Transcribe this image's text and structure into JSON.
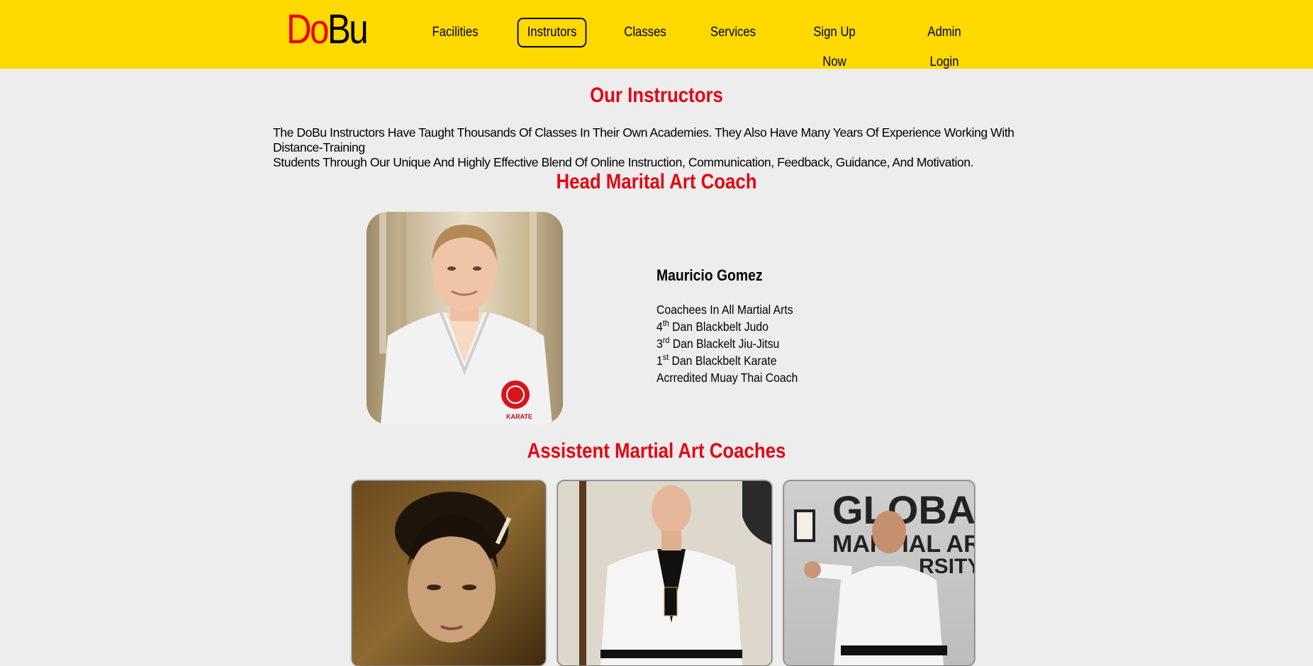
{
  "header": {
    "logo_do": "Do",
    "logo_bu": "Bu",
    "nav": [
      "Facilities",
      "Instrutors",
      "Classes",
      "Services",
      "Sign Up Now",
      "Admin Login"
    ],
    "active_nav": "Instrutors"
  },
  "main": {
    "title": "Our Instructors",
    "intro_line1": "The DoBu Instructors Have Taught Thousands Of Classes In Their Own Academies. They Also Have Many Years Of Experience Working With Distance-Training",
    "intro_line2": "Students Through Our Unique And Highly Effective Blend Of Online Instruction, Communication, Feedback, Guidance, And Motivation.",
    "head_coach_heading": "Head Marital Art Coach",
    "head_coach": {
      "name": "Mauricio Gomez",
      "line1": "Coachees In All Martial Arts",
      "line2_num": "4",
      "line2_sup": "th",
      "line2_text": " Dan Blackbelt Judo",
      "line3_num": "3",
      "line3_sup": "rd",
      "line3_text": " Dan Blackelt Jiu-Jitsu",
      "line4_num": "1",
      "line4_sup": "st",
      "line4_text": " Dan Blackbelt Karate",
      "line5": "Acrredited Muay Thai Coach",
      "gi_patch_text": "KARATE"
    },
    "assistant_heading": "Assistent Martial Art Coaches",
    "wall_sign_line1": "GLOBA",
    "wall_sign_line2": "MARTIAL AR",
    "wall_sign_line3": "RSITY"
  },
  "colors": {
    "header_bg": "#ffd900",
    "accent_red": "#e30613",
    "page_bg": "#ededed"
  }
}
